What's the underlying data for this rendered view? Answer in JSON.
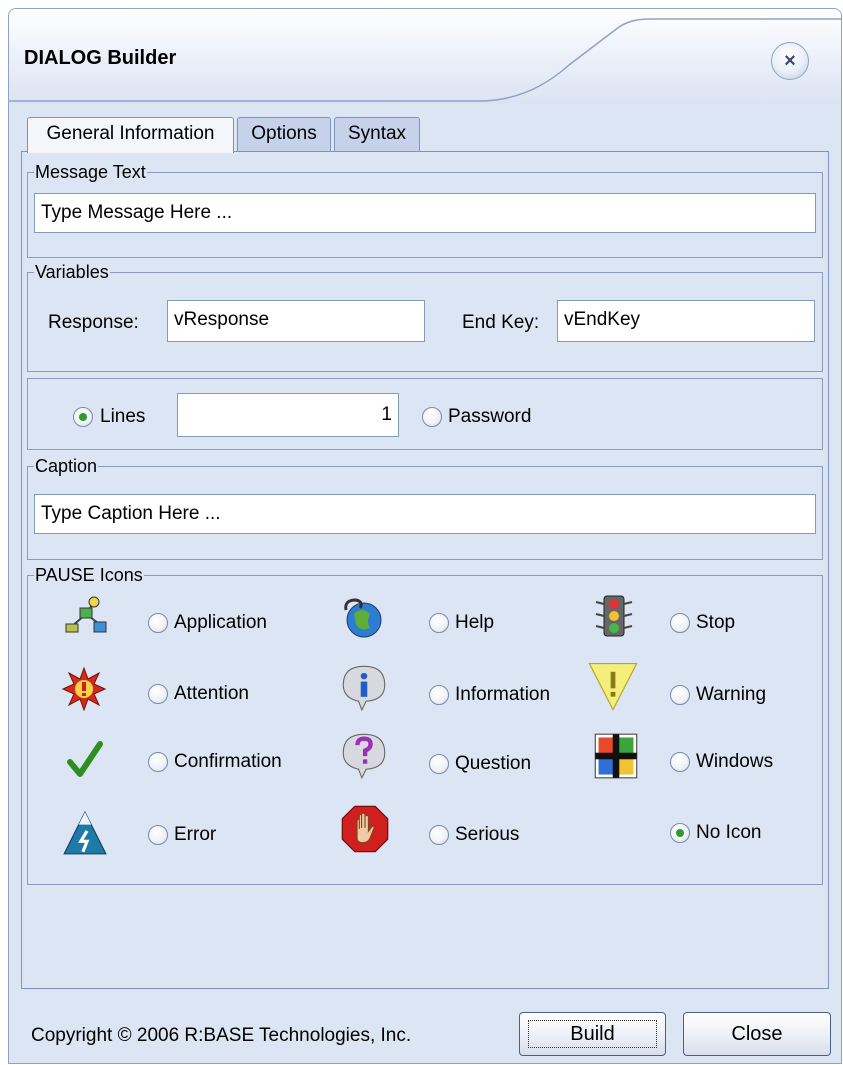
{
  "window": {
    "title": "DIALOG Builder",
    "close_symbol": "×"
  },
  "tabs": [
    {
      "label": "General Information",
      "active": true
    },
    {
      "label": "Options",
      "active": false
    },
    {
      "label": "Syntax",
      "active": false
    }
  ],
  "message_text": {
    "legend": "Message Text",
    "value": "Type Message Here ..."
  },
  "variables": {
    "legend": "Variables",
    "response_label": "Response:",
    "response_value": "vResponse",
    "end_key_label": "End Key:",
    "end_key_value": "vEndKey"
  },
  "lines": {
    "lines_label": "Lines",
    "lines_value": "1",
    "password_label": "Password",
    "selected": "lines"
  },
  "caption": {
    "legend": "Caption",
    "value": "Type Caption Here ..."
  },
  "pause_icons": {
    "legend": "PAUSE Icons",
    "selected": "No Icon",
    "options": [
      {
        "label": "Application",
        "icon": "application-icon"
      },
      {
        "label": "Help",
        "icon": "help-globe-icon"
      },
      {
        "label": "Stop",
        "icon": "traffic-light-icon"
      },
      {
        "label": "Attention",
        "icon": "attention-burst-icon"
      },
      {
        "label": "Information",
        "icon": "information-bubble-icon"
      },
      {
        "label": "Warning",
        "icon": "warning-triangle-icon"
      },
      {
        "label": "Confirmation",
        "icon": "checkmark-icon"
      },
      {
        "label": "Question",
        "icon": "question-bubble-icon"
      },
      {
        "label": "Windows",
        "icon": "windows-flag-icon"
      },
      {
        "label": "Error",
        "icon": "lightning-mountain-icon"
      },
      {
        "label": "Serious",
        "icon": "stop-hand-icon"
      },
      {
        "label": "No Icon",
        "icon": ""
      }
    ]
  },
  "footer": {
    "copyright": "Copyright © 2006 R:BASE Technologies, Inc.",
    "build_label": "Build",
    "close_label": "Close"
  },
  "colors": {
    "window_bg": "#dce5f4",
    "border": "#7f93b8",
    "radio_checked": "#2f9a2f"
  }
}
